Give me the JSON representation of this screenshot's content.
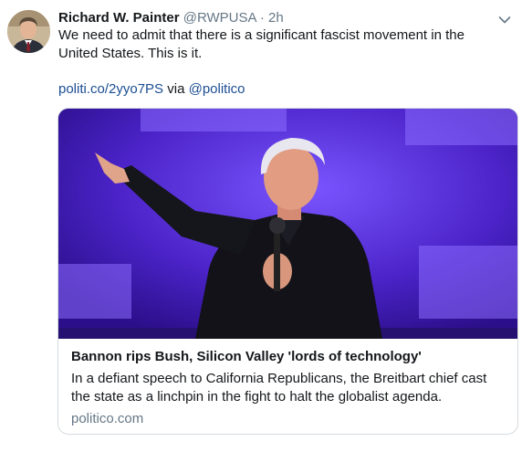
{
  "tweet": {
    "author_name": "Richard W. Painter",
    "handle": "@RWPUSA",
    "separator": "·",
    "time": "2h",
    "text": "We need to admit that there is a significant fascist movement in the United States. This is it.",
    "link_text": "politi.co/2yyo7PS",
    "via_text": "via",
    "via_handle": "@politico",
    "menu_icon": "chevron-down-icon"
  },
  "card": {
    "title": "Bannon rips Bush, Silicon Valley 'lords of technology'",
    "description": "In a defiant speech to California Republicans, the Breitbart chief cast the state as a linchpin in the fight to halt the globalist agenda.",
    "domain": "politico.com",
    "image_bg_color": "#4a22c4"
  },
  "colors": {
    "link": "#1b4d93",
    "secondary_text": "#657786",
    "border": "#d6dbdf"
  }
}
